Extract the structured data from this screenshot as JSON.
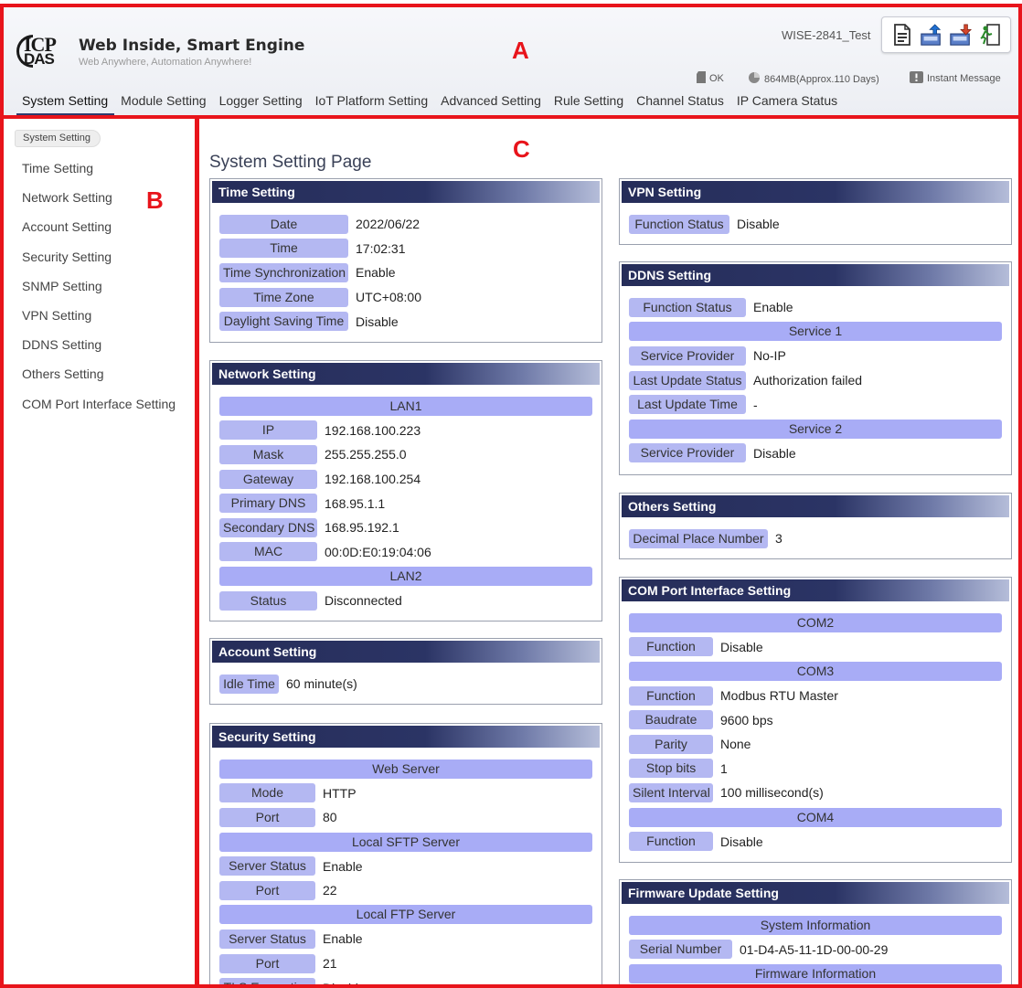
{
  "header": {
    "logo_top": "ICP",
    "logo_bottom": "DAS",
    "title": "Web Inside, Smart Engine",
    "subtitle": "Web Anywhere, Automation Anywhere!",
    "device_name": "WISE-2841_Test",
    "status_ok": "OK",
    "storage": "864MB(Approx.110 Days)",
    "instant_message": "Instant Message",
    "icons": [
      "document-icon",
      "upload-icon",
      "download-icon",
      "logout-icon"
    ]
  },
  "menu": [
    "System Setting",
    "Module Setting",
    "Logger Setting",
    "IoT Platform Setting",
    "Advanced Setting",
    "Rule Setting",
    "Channel Status",
    "IP Camera Status"
  ],
  "sidebar": {
    "breadcrumb": "System Setting",
    "items": [
      "Time Setting",
      "Network Setting",
      "Account Setting",
      "Security Setting",
      "SNMP Setting",
      "VPN Setting",
      "DDNS Setting",
      "Others Setting",
      "COM Port Interface Setting"
    ]
  },
  "annotations": [
    "A",
    "B",
    "C"
  ],
  "page_title": "System Setting Page",
  "panels": {
    "time": {
      "title": "Time Setting",
      "rows": [
        {
          "label": "Date",
          "value": "2022/06/22"
        },
        {
          "label": "Time",
          "value": "17:02:31"
        },
        {
          "label": "Time Synchronization",
          "value": "Enable"
        },
        {
          "label": "Time Zone",
          "value": "UTC+08:00"
        },
        {
          "label": "Daylight Saving Time",
          "value": "Disable"
        }
      ]
    },
    "network": {
      "title": "Network Setting",
      "lan1": "LAN1",
      "rows": [
        {
          "label": "IP",
          "value": "192.168.100.223"
        },
        {
          "label": "Mask",
          "value": "255.255.255.0"
        },
        {
          "label": "Gateway",
          "value": "192.168.100.254"
        },
        {
          "label": "Primary DNS",
          "value": "168.95.1.1"
        },
        {
          "label": "Secondary DNS",
          "value": "168.95.192.1"
        },
        {
          "label": "MAC",
          "value": "00:0D:E0:19:04:06"
        }
      ],
      "lan2": "LAN2",
      "lan2_rows": [
        {
          "label": "Status",
          "value": "Disconnected"
        }
      ]
    },
    "account": {
      "title": "Account Setting",
      "rows": [
        {
          "label": "Idle Time",
          "value": "60 minute(s)"
        }
      ]
    },
    "security": {
      "title": "Security Setting",
      "web_server": "Web Server",
      "web_rows": [
        {
          "label": "Mode",
          "value": "HTTP"
        },
        {
          "label": "Port",
          "value": "80"
        }
      ],
      "sftp": "Local SFTP Server",
      "sftp_rows": [
        {
          "label": "Server Status",
          "value": "Enable"
        },
        {
          "label": "Port",
          "value": "22"
        }
      ],
      "ftp": "Local FTP Server",
      "ftp_rows": [
        {
          "label": "Server Status",
          "value": "Enable"
        },
        {
          "label": "Port",
          "value": "21"
        },
        {
          "label": "TLS Encryption",
          "value": "Disable"
        }
      ]
    },
    "vpn": {
      "title": "VPN Setting",
      "rows": [
        {
          "label": "Function Status",
          "value": "Disable"
        }
      ]
    },
    "ddns": {
      "title": "DDNS Setting",
      "rows": [
        {
          "label": "Function Status",
          "value": "Enable"
        }
      ],
      "service1": "Service 1",
      "s1_rows": [
        {
          "label": "Service Provider",
          "value": "No-IP"
        },
        {
          "label": "Last Update Status",
          "value": "Authorization failed"
        },
        {
          "label": "Last Update Time",
          "value": "-"
        }
      ],
      "service2": "Service 2",
      "s2_rows": [
        {
          "label": "Service Provider",
          "value": "Disable"
        }
      ]
    },
    "others": {
      "title": "Others Setting",
      "rows": [
        {
          "label": "Decimal Place Number",
          "value": "3"
        }
      ]
    },
    "com": {
      "title": "COM Port Interface Setting",
      "com2": "COM2",
      "com2_rows": [
        {
          "label": "Function",
          "value": "Disable"
        }
      ],
      "com3": "COM3",
      "com3_rows": [
        {
          "label": "Function",
          "value": "Modbus RTU Master"
        },
        {
          "label": "Baudrate",
          "value": "9600 bps"
        },
        {
          "label": "Parity",
          "value": "None"
        },
        {
          "label": "Stop bits",
          "value": "1"
        },
        {
          "label": "Silent Interval",
          "value": "100 millisecond(s)"
        }
      ],
      "com4": "COM4",
      "com4_rows": [
        {
          "label": "Function",
          "value": "Disable"
        }
      ]
    },
    "firmware": {
      "title": "Firmware Update Setting",
      "sysinfo": "System Information",
      "rows": [
        {
          "label": "Serial Number",
          "value": "01-D4-A5-11-1D-00-00-29"
        }
      ],
      "fwinfo": "Firmware Information"
    }
  }
}
